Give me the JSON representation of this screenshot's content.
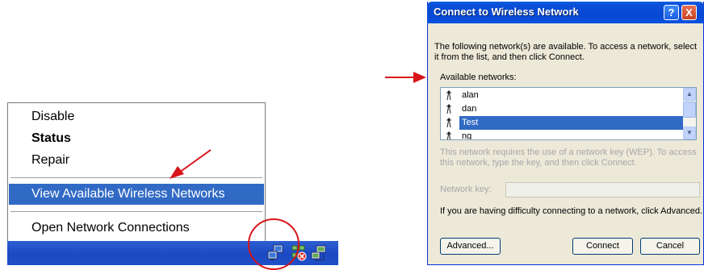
{
  "context_menu": {
    "items": [
      {
        "label": "Disable"
      },
      {
        "label": "Status"
      },
      {
        "label": "Repair"
      },
      {
        "label": "View Available Wireless Networks"
      },
      {
        "label": "Open Network Connections"
      }
    ]
  },
  "dialog": {
    "title": "Connect to Wireless Network",
    "help_button": "?",
    "close_button": "X",
    "intro_line1": "The following network(s) are available. To access a network, select",
    "intro_line2": "it from the list, and then click Connect.",
    "available_label": "Available networks:",
    "networks": [
      {
        "name": "alan"
      },
      {
        "name": "dan"
      },
      {
        "name": "Test"
      },
      {
        "name": "ng"
      }
    ],
    "wep_line1": "This network requires the use of a network key (WEP). To access",
    "wep_line2": "this network, type the key, and then click Connect.",
    "key_label": "Network key:",
    "key_value": "",
    "help_text": "If you are having difficulty connecting to a network, click Advanced.",
    "advanced_button": "Advanced...",
    "connect_button": "Connect",
    "cancel_button": "Cancel"
  },
  "colors": {
    "selection": "#316ac5",
    "annotation": "#d8141a",
    "titlebar": "#0748d4",
    "dialog_bg": "#ece9d8"
  }
}
